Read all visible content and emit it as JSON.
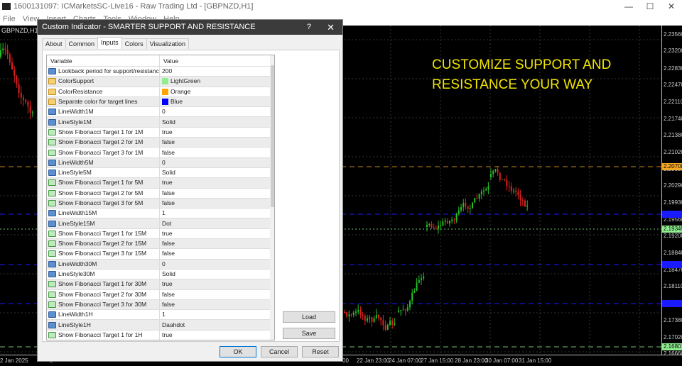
{
  "window": {
    "title": "1600131097: ICMarketsSC-Live16 - Raw Trading Ltd - [GBPNZD,H1]",
    "menu": [
      "File",
      "View",
      "Insert",
      "Charts",
      "Tools",
      "Window",
      "Help"
    ]
  },
  "chart": {
    "symbol": "GBPNZD,H1",
    "promo_line1": "CUSTOMIZE SUPPORT AND",
    "promo_line2": "RESISTANCE YOUR WAY",
    "price_labels": [
      "2.23560",
      "2.23200",
      "2.22830",
      "2.22470",
      "2.22110",
      "2.21740",
      "2.21380",
      "2.21020",
      "2.20650",
      "2.20290",
      "2.19930",
      "2.19560",
      "2.19200",
      "2.18840",
      "2.18470",
      "2.18110",
      "2.17380",
      "2.17020",
      "2.16660"
    ],
    "levels": [
      {
        "price": "2.20708",
        "color": "#f5a623",
        "style": "dashed"
      },
      {
        "price": "",
        "color": "#1a1aff",
        "style": "dashed"
      },
      {
        "price": "2.19349",
        "color": "#90ee90",
        "style": "dotted"
      },
      {
        "price": "",
        "color": "#1a1aff",
        "style": "dashed"
      },
      {
        "price": "",
        "color": "#1a1aff",
        "style": "dashed"
      },
      {
        "price": "2.16801",
        "color": "#90ee90",
        "style": "dashed"
      }
    ],
    "time_labels": [
      "2 Jan 2025",
      "3",
      "00",
      "22 Jan 23:00",
      "24 Jan 07:00",
      "27 Jan 15:00",
      "28 Jan 23:00",
      "30 Jan 07:00",
      "31 Jan 15:00"
    ]
  },
  "dialog": {
    "title": "Custom Indicator - SMARTER SUPPORT AND RESISTANCE",
    "help": "?",
    "close": "✕",
    "tabs": [
      "About",
      "Common",
      "Inputs",
      "Colors",
      "Visualization"
    ],
    "active_tab": "Inputs",
    "columns": [
      "Variable",
      "Value"
    ],
    "rows": [
      {
        "type": "int",
        "name": "Lookback period for support/resistance",
        "value": "200"
      },
      {
        "type": "col",
        "name": "ColorSupport",
        "value": "LightGreen",
        "swatch": "#90ee90"
      },
      {
        "type": "col",
        "name": "ColorResistance",
        "value": "Orange",
        "swatch": "#ffa500"
      },
      {
        "type": "col",
        "name": "Separate color for target lines",
        "value": "Blue",
        "swatch": "#0000ff"
      },
      {
        "type": "int",
        "name": "LineWidth1M",
        "value": "0"
      },
      {
        "type": "int",
        "name": "LineStyle1M",
        "value": "Solid"
      },
      {
        "type": "bool",
        "name": "Show Fibonacci Target 1 for 1M",
        "value": "true"
      },
      {
        "type": "bool",
        "name": "Show Fibonacci Target 2 for 1M",
        "value": "false"
      },
      {
        "type": "bool",
        "name": "Show Fibonacci Target 3 for 1M",
        "value": "false"
      },
      {
        "type": "int",
        "name": "LineWidth5M",
        "value": "0"
      },
      {
        "type": "int",
        "name": "LineStyle5M",
        "value": "Solid"
      },
      {
        "type": "bool",
        "name": "Show Fibonacci Target 1 for 5M",
        "value": "true"
      },
      {
        "type": "bool",
        "name": "Show Fibonacci Target 2 for 5M",
        "value": "false"
      },
      {
        "type": "bool",
        "name": "Show Fibonacci Target 3 for 5M",
        "value": "false"
      },
      {
        "type": "int",
        "name": "LineWidth15M",
        "value": "1"
      },
      {
        "type": "int",
        "name": "LineStyle15M",
        "value": "Dot"
      },
      {
        "type": "bool",
        "name": "Show Fibonacci Target 1 for 15M",
        "value": "true"
      },
      {
        "type": "bool",
        "name": "Show Fibonacci Target 2 for 15M",
        "value": "false"
      },
      {
        "type": "bool",
        "name": "Show Fibonacci Target 3 for 15M",
        "value": "false"
      },
      {
        "type": "int",
        "name": "LineWidth30M",
        "value": "0"
      },
      {
        "type": "int",
        "name": "LineStyle30M",
        "value": "Solid"
      },
      {
        "type": "bool",
        "name": "Show Fibonacci Target 1 for 30M",
        "value": "true"
      },
      {
        "type": "bool",
        "name": "Show Fibonacci Target 2 for 30M",
        "value": "false"
      },
      {
        "type": "bool",
        "name": "Show Fibonacci Target 3 for 30M",
        "value": "false"
      },
      {
        "type": "int",
        "name": "LineWidth1H",
        "value": "1"
      },
      {
        "type": "int",
        "name": "LineStyle1H",
        "value": "Daahdot"
      },
      {
        "type": "bool",
        "name": "Show Fibonacci Target 1 for 1H",
        "value": "true"
      }
    ],
    "buttons": {
      "load": "Load",
      "save": "Save",
      "ok": "OK",
      "cancel": "Cancel",
      "reset": "Reset"
    }
  }
}
